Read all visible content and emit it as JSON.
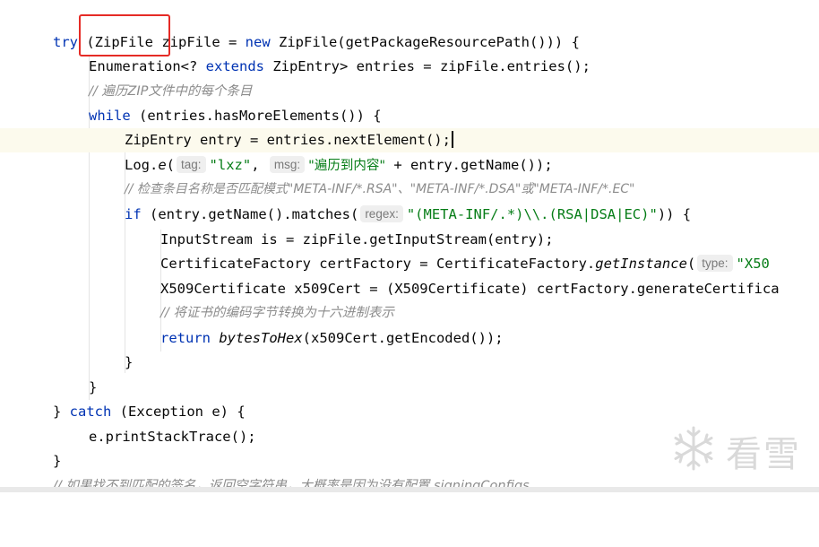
{
  "editor": {
    "lines": [
      {
        "id": "l1",
        "tokens": [
          [
            "kw",
            "try"
          ],
          [
            "p",
            " ("
          ],
          [
            "p",
            "ZipFile"
          ],
          [
            "p",
            " zipFile = "
          ],
          [
            "kw",
            "new"
          ],
          [
            "p",
            " ZipFile(getPackageResourcePath())) {"
          ]
        ]
      },
      {
        "id": "l2",
        "tokens": [
          [
            "p",
            "Enumeration<? "
          ],
          [
            "kw",
            "extends"
          ],
          [
            "p",
            " ZipEntry> entries = zipFile.entries();"
          ]
        ]
      },
      {
        "id": "l3",
        "comment": "// 遍历ZIP文件中的每个条目"
      },
      {
        "id": "l4",
        "tokens": [
          [
            "kw",
            "while"
          ],
          [
            "p",
            " (entries.hasMoreElements()) {"
          ]
        ]
      },
      {
        "id": "l5",
        "tokens": [
          [
            "p",
            "ZipEntry entry = entries.nextElement();"
          ]
        ]
      },
      {
        "id": "l6",
        "log_prefix": "Log.",
        "log_method": "e",
        "log_open": "(",
        "hint_tag": "tag:",
        "str_tag": "\"lxz\"",
        "comma": ",",
        "hint_msg": "msg:",
        "str_msg": "\"遍历到内容\"",
        "rest": " + entry.getName());"
      },
      {
        "id": "l7",
        "comment": "// 检查条目名称是否匹配模式\"META-INF/*.RSA\"、\"META-INF/*.DSA\"或\"META-INF/*.EC\""
      },
      {
        "id": "l8",
        "kw_if": "if",
        "pre": " (entry.getName().matches(",
        "hint_regex": "regex:",
        "str_regex": "\"(META-INF/.*)\\\\.(RSA|DSA|EC)\"",
        "post": ")) {"
      },
      {
        "id": "l9",
        "tokens": [
          [
            "p",
            "InputStream is = zipFile.getInputStream(entry);"
          ]
        ]
      },
      {
        "id": "l10",
        "pre": "CertificateFactory certFactory = CertificateFactory.",
        "method": "getInstance",
        "open": "(",
        "hint_type": "type:",
        "str_type": "\"X50"
      },
      {
        "id": "l11",
        "tokens": [
          [
            "p",
            "X509Certificate x509Cert = (X509Certificate) certFactory.generateCertifica"
          ]
        ]
      },
      {
        "id": "l12",
        "comment": "// 将证书的编码字节转换为十六进制表示"
      },
      {
        "id": "l13",
        "kw_return": "return",
        "method": "bytesToHex",
        "rest": "(x509Cert.getEncoded());"
      },
      {
        "id": "l14",
        "tokens": [
          [
            "p",
            "}"
          ]
        ]
      },
      {
        "id": "l15",
        "tokens": [
          [
            "p",
            "}"
          ]
        ]
      },
      {
        "id": "l16",
        "tokens": [
          [
            "p",
            "} "
          ],
          [
            "kw",
            "catch"
          ],
          [
            "p",
            " (Exception e) {"
          ]
        ]
      },
      {
        "id": "l17",
        "tokens": [
          [
            "p",
            "e.printStackTrace();"
          ]
        ]
      },
      {
        "id": "l18",
        "tokens": [
          [
            "p",
            "}"
          ]
        ]
      },
      {
        "id": "l19",
        "comment": "// 如果找不到匹配的签名，返回空字符串，大概率是因为没有配置 signingConfigs"
      }
    ]
  },
  "watermark": {
    "text": "看雪",
    "icon": "snowflake-icon"
  },
  "colors": {
    "keyword": "#0033b3",
    "string": "#067d17",
    "comment": "#8c8c8c",
    "highlight_box": "#e52b26"
  }
}
